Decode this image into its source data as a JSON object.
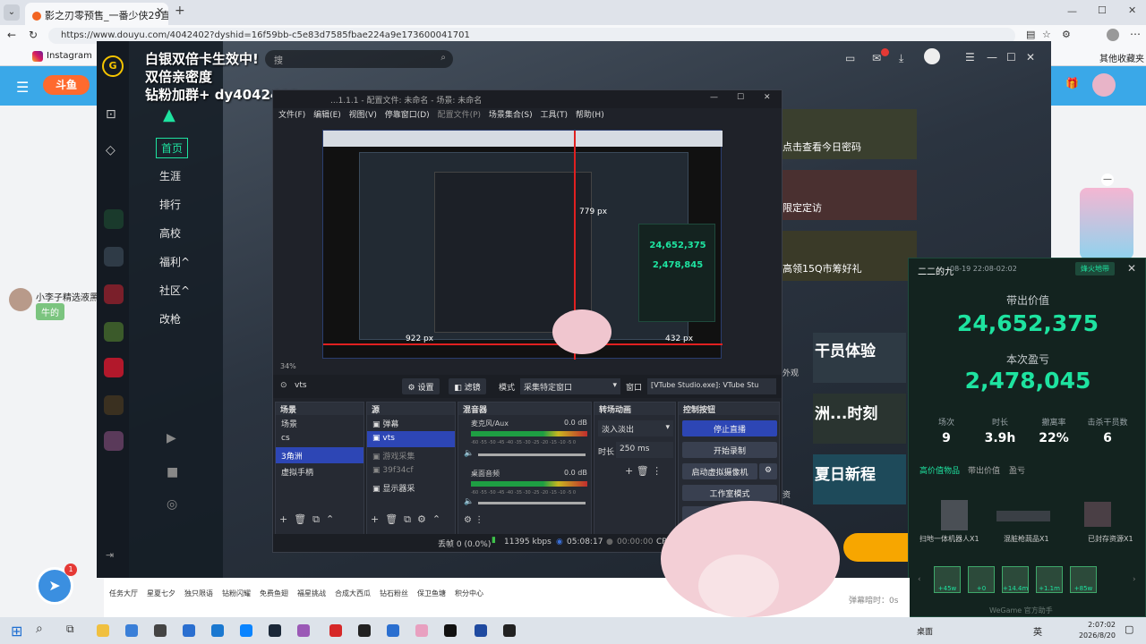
{
  "browser": {
    "tab_title": "影之刃零预售_一番少侠29直播_一",
    "url": "https://www.douyu.com/4042402?dyshid=16f59bb-c5e83d7585fbae224a9e173600041701",
    "bookmarks": [
      {
        "label": "Instagram"
      },
      {
        "label": "其他收藏夹"
      }
    ]
  },
  "douyu": {
    "banner_lines": [
      "白银双倍卡生效中!",
      "双倍亲密度",
      "钻粉加群+ dy4042402"
    ],
    "side_menu": [
      "首页",
      "生涯",
      "排行",
      "高校",
      "福利^",
      "社区^",
      "改枪"
    ],
    "search_placeholder": "搜",
    "comment_user": "小李子精选液黑大箱",
    "comment_text": "牛的",
    "right_cards": [
      {
        "title": "点击查看今日密码"
      },
      {
        "title": "限定定访"
      },
      {
        "title": "高领15Q市筹好礼"
      },
      {
        "title": "干员体验"
      },
      {
        "title": "洲...时刻"
      },
      {
        "title": "夏日新程"
      }
    ],
    "side_tags": [
      "外观",
      "资"
    ],
    "toolbar_items": [
      "任务大厅",
      "星夏七夕",
      "独只限语",
      "钻粉闪耀",
      "免费鱼翅",
      "福星挑战",
      "合成大西瓜",
      "钻石粉丝",
      "保卫鱼塘",
      "积分中心"
    ],
    "bottom_hint": "弹幕暗时：0s",
    "badge_count": "1"
  },
  "obs": {
    "title": "...1.1.1 - 配置文件: 未命名 - 场景: 未命名",
    "menu": [
      "文件(F)",
      "编辑(E)",
      "视图(V)",
      "停靠窗口(D)",
      "配置文件(P)",
      "场景集合(S)",
      "工具(T)",
      "帮助(H)"
    ],
    "preview_labels": {
      "dim_top": "779 px",
      "dim_left": "922 px",
      "dim_right": "432 px",
      "mini_number1": "24,652,375",
      "mini_number2": "2,478,845"
    },
    "zoom": "34%",
    "source_name": "vts",
    "settings_btn": "设置",
    "filter_btn": "滤镜",
    "mode_label": "模式",
    "mode_value": "采集特定窗口",
    "window_label": "窗口",
    "window_value": "[VTube Studio.exe]: VTube Stu",
    "panels": {
      "scenes": {
        "title": "场景",
        "items": [
          "场景",
          "cs",
          "3角洲",
          "虚拟手柄"
        ],
        "selected": 2
      },
      "sources": {
        "title": "源",
        "items": [
          "弹幕",
          "vts",
          "游戏采集",
          "39f34cf",
          "显示器采"
        ],
        "selected": 1
      },
      "mixer": {
        "title": "混音器",
        "ch1": "麦克风/Aux",
        "ch1_db": "0.0 dB",
        "ch2": "桌面音频",
        "ch2_db": "0.0 dB",
        "scale": "-60 -55 -50 -45 -40 -35 -30 -25 -20 -15 -10 -5 0"
      },
      "transitions": {
        "title": "转场动画",
        "type": "淡入淡出",
        "duration_label": "时长",
        "duration": "250 ms"
      },
      "controls": {
        "title": "控制按钮",
        "buttons": [
          "停止直播",
          "开始录制",
          "启动虚拟摄像机",
          "工作室模式",
          "设置"
        ]
      }
    },
    "status": {
      "dropped": "丢帧 0 (0.0%)",
      "bitrate": "11395 kbps",
      "live_time": "05:08:17",
      "rec_time": "00:00:00",
      "cpu": "CP"
    }
  },
  "overlay": {
    "user": "二二的九",
    "timestamp": "08-19 22:08-02:02",
    "tag": "烽火地带",
    "label1": "带出价值",
    "value1": "24,652,375",
    "label2": "本次盈亏",
    "value2": "2,478,045",
    "stats": [
      {
        "k": "场次",
        "v": "9"
      },
      {
        "k": "时长",
        "v": "3.9h"
      },
      {
        "k": "撤离率",
        "v": "22%"
      },
      {
        "k": "击杀干员数",
        "v": "6"
      }
    ],
    "tabs": [
      "高价值物品",
      "带出价值",
      "盈亏"
    ],
    "items": [
      "扫地一体机器人X1",
      "混脏枪蔬品X1",
      "已封存资源X1"
    ],
    "kills": [
      "+45w",
      "+0",
      "+14.4m",
      "+1.1m",
      "+85w"
    ],
    "footer": "WeGame 官方助手"
  },
  "taskbar": {
    "desktop_label": "桌面",
    "lang": "英",
    "time": "2:07:02",
    "date": "2026/8/20"
  }
}
